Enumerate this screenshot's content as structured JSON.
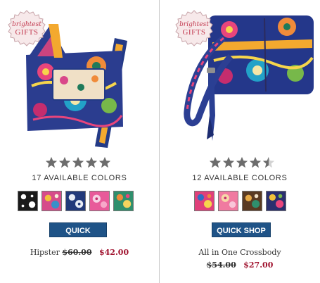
{
  "badge": {
    "line1": "brightest",
    "line2": "GIFTS"
  },
  "products": [
    {
      "name": "Hipster",
      "rating": 5,
      "colors_text": "17 AVAILABLE COLORS",
      "old_price": "$60.00",
      "new_price": "$42.00",
      "button_label": "QUICK SHOP",
      "swatches": [
        {
          "bg": "#1a1a1a",
          "accent": "#ffffff"
        },
        {
          "bg": "#d64c8a",
          "accent": "#f2c23a"
        },
        {
          "bg": "#223a7a",
          "accent": "#e9eef6"
        },
        {
          "bg": "#e85a9a",
          "accent": "#f7d2e4"
        },
        {
          "bg": "#2f8f6d",
          "accent": "#f08b3a"
        }
      ]
    },
    {
      "name": "All in One Crossbody",
      "rating": 4.5,
      "colors_text": "12 AVAILABLE COLORS",
      "old_price": "$54.00",
      "new_price": "$27.00",
      "button_label": "QUICK SHOP",
      "swatches": [
        {
          "bg": "#e0407a",
          "accent": "#2f6ec4"
        },
        {
          "bg": "#f07aa0",
          "accent": "#f6d9a8"
        },
        {
          "bg": "#5a3a22",
          "accent": "#e6a845"
        },
        {
          "bg": "#2a2f6e",
          "accent": "#f2c23a"
        }
      ]
    }
  ],
  "colors": {
    "button_bg": "#1f5387",
    "sale_price": "#a0122e",
    "star_on": "#6c6c6c",
    "star_off": "#d2d2d2",
    "badge_text": "#c23a50"
  }
}
